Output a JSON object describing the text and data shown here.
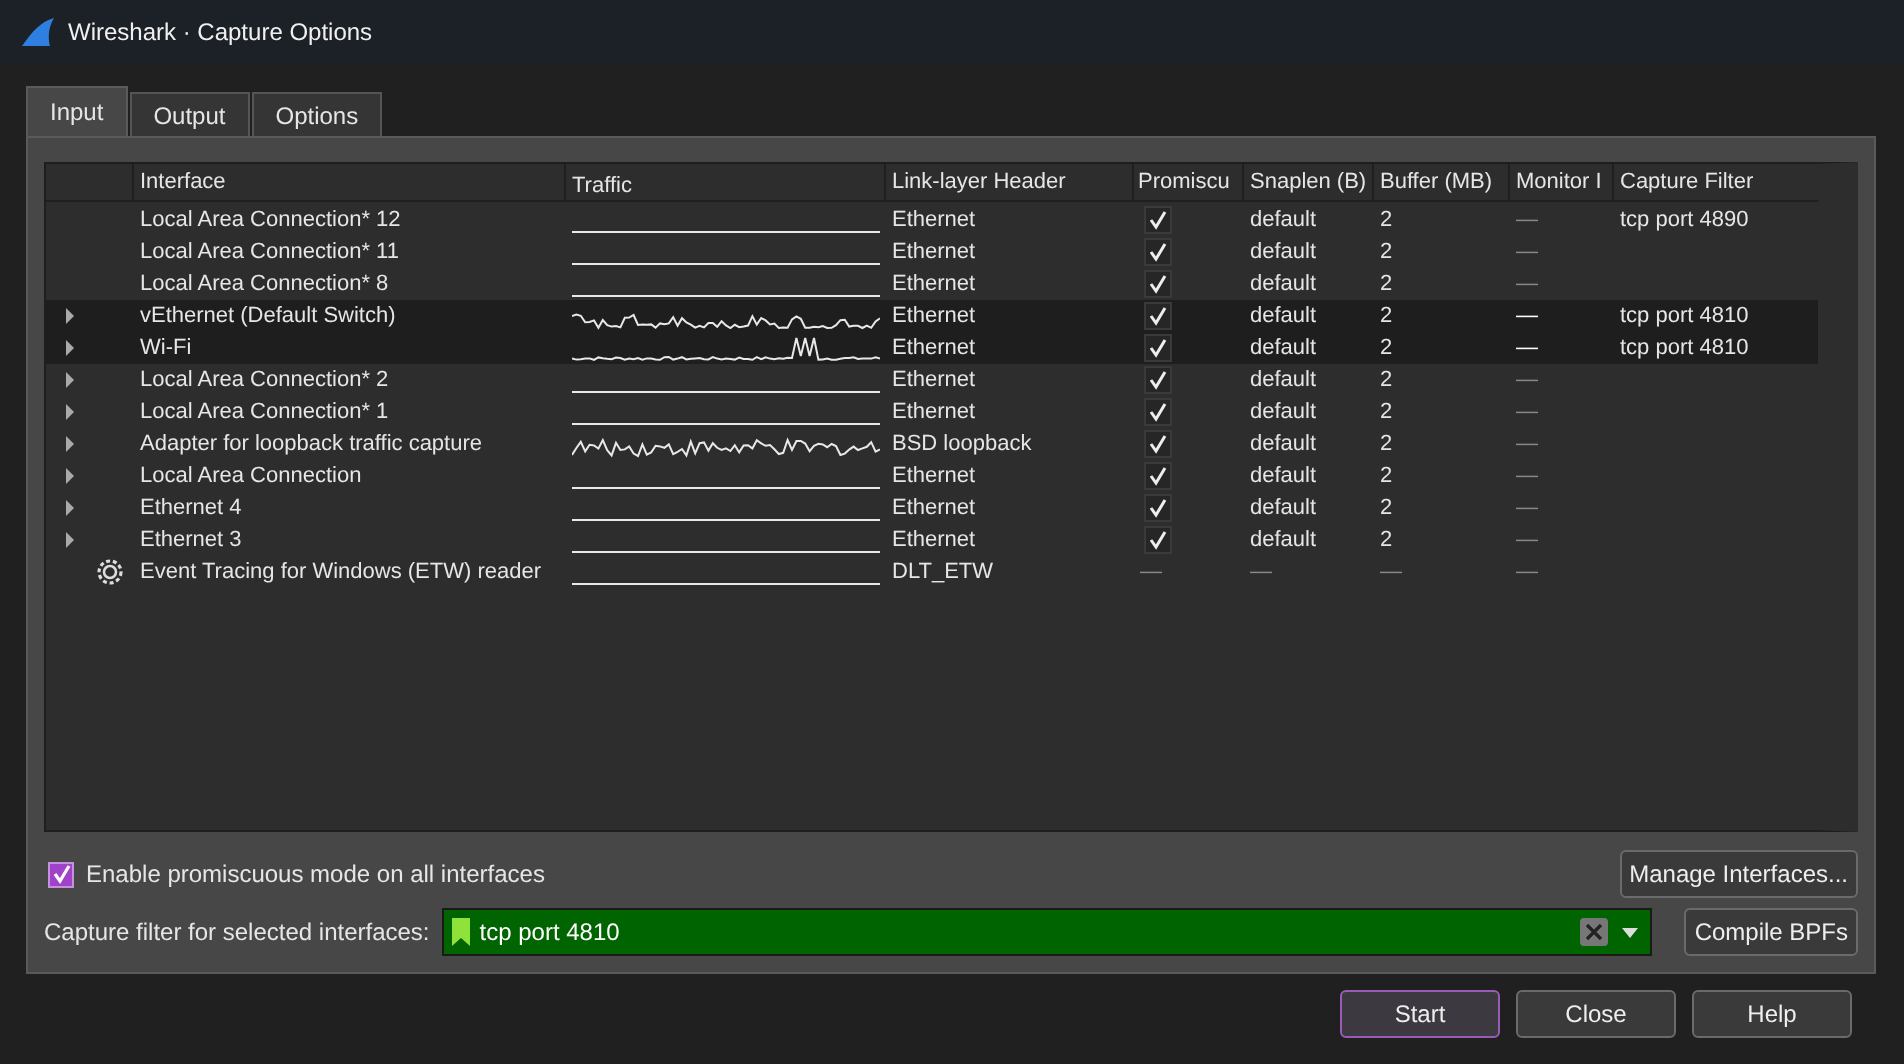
{
  "window": {
    "title": "Wireshark · Capture Options"
  },
  "tabs": [
    {
      "label": "Input",
      "selected": true
    },
    {
      "label": "Output",
      "selected": false
    },
    {
      "label": "Options",
      "selected": false
    }
  ],
  "table": {
    "columns": [
      "Interface",
      "Traffic",
      "Link-layer Header",
      "Promiscu",
      "Snaplen (B)",
      "Buffer (MB)",
      "Monitor I",
      "Capture Filter"
    ],
    "rows": [
      {
        "kind": "interface",
        "expandable": false,
        "selected": false,
        "interface": "Local Area Connection* 12",
        "traffic": {
          "kind": "idle"
        },
        "link_layer": "Ethernet",
        "promiscuous": {
          "kind": "checkbox",
          "checked": true
        },
        "snaplen": "default",
        "buffer": "2",
        "monitor": "—",
        "filter": "tcp port 4890"
      },
      {
        "kind": "interface",
        "expandable": false,
        "selected": false,
        "interface": "Local Area Connection* 11",
        "traffic": {
          "kind": "idle"
        },
        "link_layer": "Ethernet",
        "promiscuous": {
          "kind": "checkbox",
          "checked": true
        },
        "snaplen": "default",
        "buffer": "2",
        "monitor": "—"
      },
      {
        "kind": "interface",
        "expandable": false,
        "selected": false,
        "interface": "Local Area Connection* 8",
        "traffic": {
          "kind": "idle"
        },
        "link_layer": "Ethernet",
        "promiscuous": {
          "kind": "checkbox",
          "checked": true
        },
        "snaplen": "default",
        "buffer": "2",
        "monitor": "—"
      },
      {
        "kind": "interface",
        "expandable": true,
        "selected": true,
        "interface": "vEthernet (Default Switch)",
        "traffic": {
          "kind": "wavy"
        },
        "link_layer": "Ethernet",
        "promiscuous": {
          "kind": "checkbox",
          "checked": true
        },
        "snaplen": "default",
        "buffer": "2",
        "monitor": "—",
        "filter": "tcp port 4810"
      },
      {
        "kind": "interface",
        "expandable": true,
        "selected": true,
        "interface": "Wi-Fi",
        "traffic": {
          "kind": "spike"
        },
        "link_layer": "Ethernet",
        "promiscuous": {
          "kind": "checkbox",
          "checked": true
        },
        "snaplen": "default",
        "buffer": "2",
        "monitor": "—",
        "filter": "tcp port 4810"
      },
      {
        "kind": "interface",
        "expandable": true,
        "selected": false,
        "interface": "Local Area Connection* 2",
        "traffic": {
          "kind": "idle"
        },
        "link_layer": "Ethernet",
        "promiscuous": {
          "kind": "checkbox",
          "checked": true
        },
        "snaplen": "default",
        "buffer": "2",
        "monitor": "—"
      },
      {
        "kind": "interface",
        "expandable": true,
        "selected": false,
        "interface": "Local Area Connection* 1",
        "traffic": {
          "kind": "idle"
        },
        "link_layer": "Ethernet",
        "promiscuous": {
          "kind": "checkbox",
          "checked": true
        },
        "snaplen": "default",
        "buffer": "2",
        "monitor": "—"
      },
      {
        "kind": "interface",
        "expandable": true,
        "selected": false,
        "interface": "Adapter for loopback traffic capture",
        "traffic": {
          "kind": "busy"
        },
        "link_layer": "BSD loopback",
        "promiscuous": {
          "kind": "checkbox",
          "checked": true
        },
        "snaplen": "default",
        "buffer": "2",
        "monitor": "—"
      },
      {
        "kind": "interface",
        "expandable": true,
        "selected": false,
        "interface": "Local Area Connection",
        "traffic": {
          "kind": "idle"
        },
        "link_layer": "Ethernet",
        "promiscuous": {
          "kind": "checkbox",
          "checked": true
        },
        "snaplen": "default",
        "buffer": "2",
        "monitor": "—"
      },
      {
        "kind": "interface",
        "expandable": true,
        "selected": false,
        "interface": "Ethernet 4",
        "traffic": {
          "kind": "idle"
        },
        "link_layer": "Ethernet",
        "promiscuous": {
          "kind": "checkbox",
          "checked": true
        },
        "snaplen": "default",
        "buffer": "2",
        "monitor": "—"
      },
      {
        "kind": "interface",
        "expandable": true,
        "selected": false,
        "interface": "Ethernet 3",
        "traffic": {
          "kind": "idle"
        },
        "link_layer": "Ethernet",
        "promiscuous": {
          "kind": "checkbox",
          "checked": true
        },
        "snaplen": "default",
        "buffer": "2",
        "monitor": "—"
      },
      {
        "kind": "extcap",
        "expandable": false,
        "selected": false,
        "interface": "Event Tracing for Windows (ETW) reader",
        "traffic": {
          "kind": "idle"
        },
        "link_layer": "DLT_ETW",
        "promiscuous": {
          "kind": "text",
          "text": "—"
        },
        "snaplen": "—",
        "buffer": "—",
        "monitor": "—"
      }
    ]
  },
  "promiscuous_all": {
    "label": "Enable promiscuous mode on all interfaces",
    "checked": true
  },
  "manage_button": "Manage Interfaces...",
  "capture_filter": {
    "label": "Capture filter for selected interfaces:",
    "value": "tcp port 4810",
    "valid": true
  },
  "compile_button": "Compile BPFs",
  "buttons": [
    {
      "label": "Start",
      "default": true
    },
    {
      "label": "Close",
      "default": false
    },
    {
      "label": "Help",
      "default": false
    }
  ]
}
